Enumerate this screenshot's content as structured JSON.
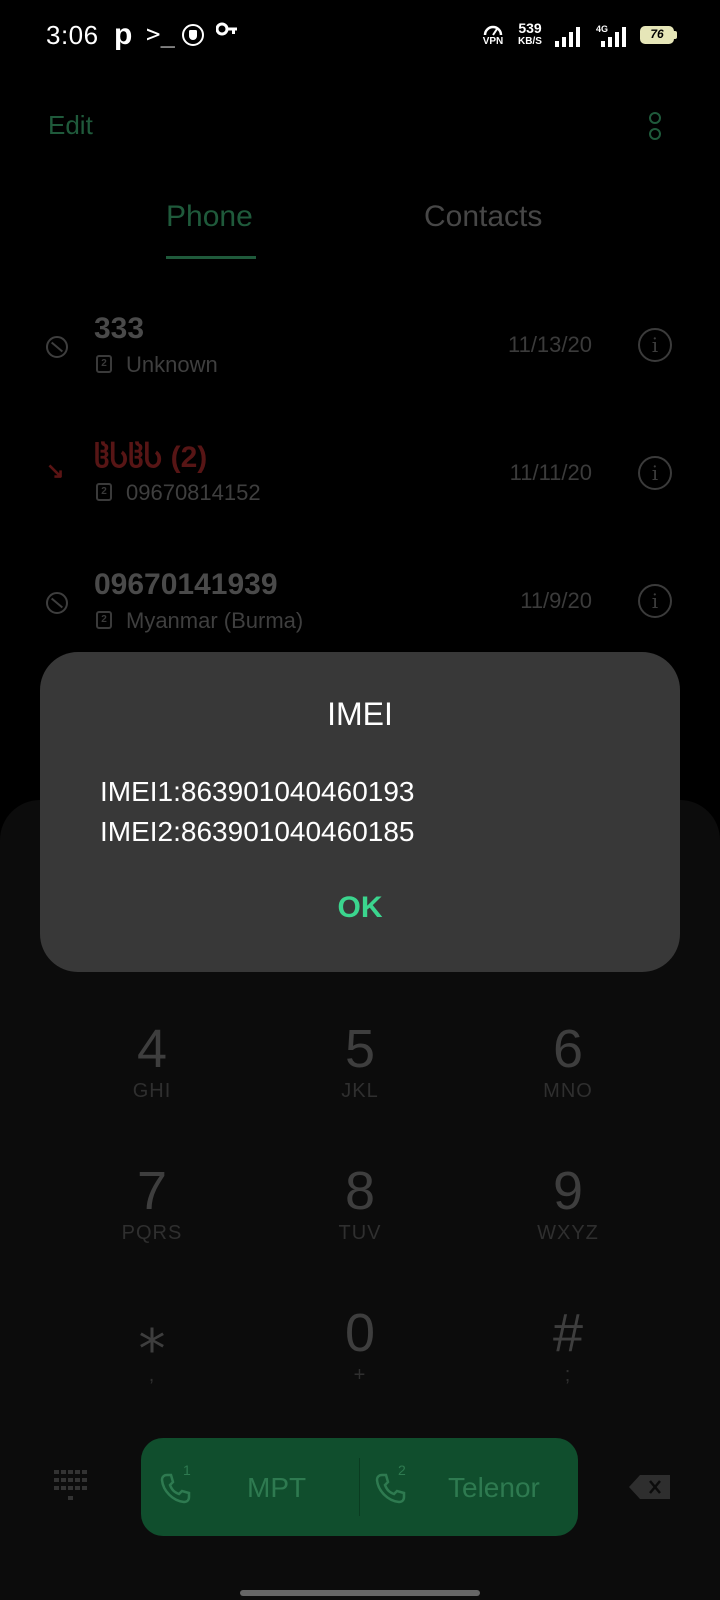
{
  "status_bar": {
    "time": "3:06",
    "p_label": "p",
    "terminal_label": ">_",
    "vpn_label": "VPN",
    "speed_value": "539",
    "speed_unit": "KB/S",
    "network_label": "4G",
    "battery": "76"
  },
  "header": {
    "edit_label": "Edit"
  },
  "tabs": {
    "phone": "Phone",
    "contacts": "Contacts"
  },
  "calls": [
    {
      "name": "333",
      "detail": "Unknown",
      "date": "11/13/20",
      "status": "blocked",
      "sim": "2"
    },
    {
      "name": "ჱႱჱႱ (2)",
      "detail": "09670814152",
      "date": "11/11/20",
      "status": "missed",
      "sim": "2"
    },
    {
      "name": "09670141939",
      "detail": "Myanmar (Burma)",
      "date": "11/9/20",
      "status": "blocked",
      "sim": "2"
    }
  ],
  "dialog": {
    "title": "IMEI",
    "line1": "IMEI1:863901040460193",
    "line2": "IMEI2:863901040460185",
    "ok_label": "OK"
  },
  "dialpad": {
    "keys": [
      {
        "digit": "4",
        "letters": "GHI"
      },
      {
        "digit": "5",
        "letters": "JKL"
      },
      {
        "digit": "6",
        "letters": "MNO"
      },
      {
        "digit": "7",
        "letters": "PQRS"
      },
      {
        "digit": "8",
        "letters": "TUV"
      },
      {
        "digit": "9",
        "letters": "WXYZ"
      },
      {
        "digit": "⁎",
        "letters": ","
      },
      {
        "digit": "0",
        "letters": "+"
      },
      {
        "digit": "#",
        "letters": ";"
      }
    ],
    "sim1_num": "1",
    "sim1_carrier": "MPT",
    "sim2_num": "2",
    "sim2_carrier": "Telenor"
  },
  "colors": {
    "accent": "#3bd58e",
    "dim_accent": "#1f5a3b",
    "missed": "#571515",
    "dialog_bg": "#383838"
  }
}
